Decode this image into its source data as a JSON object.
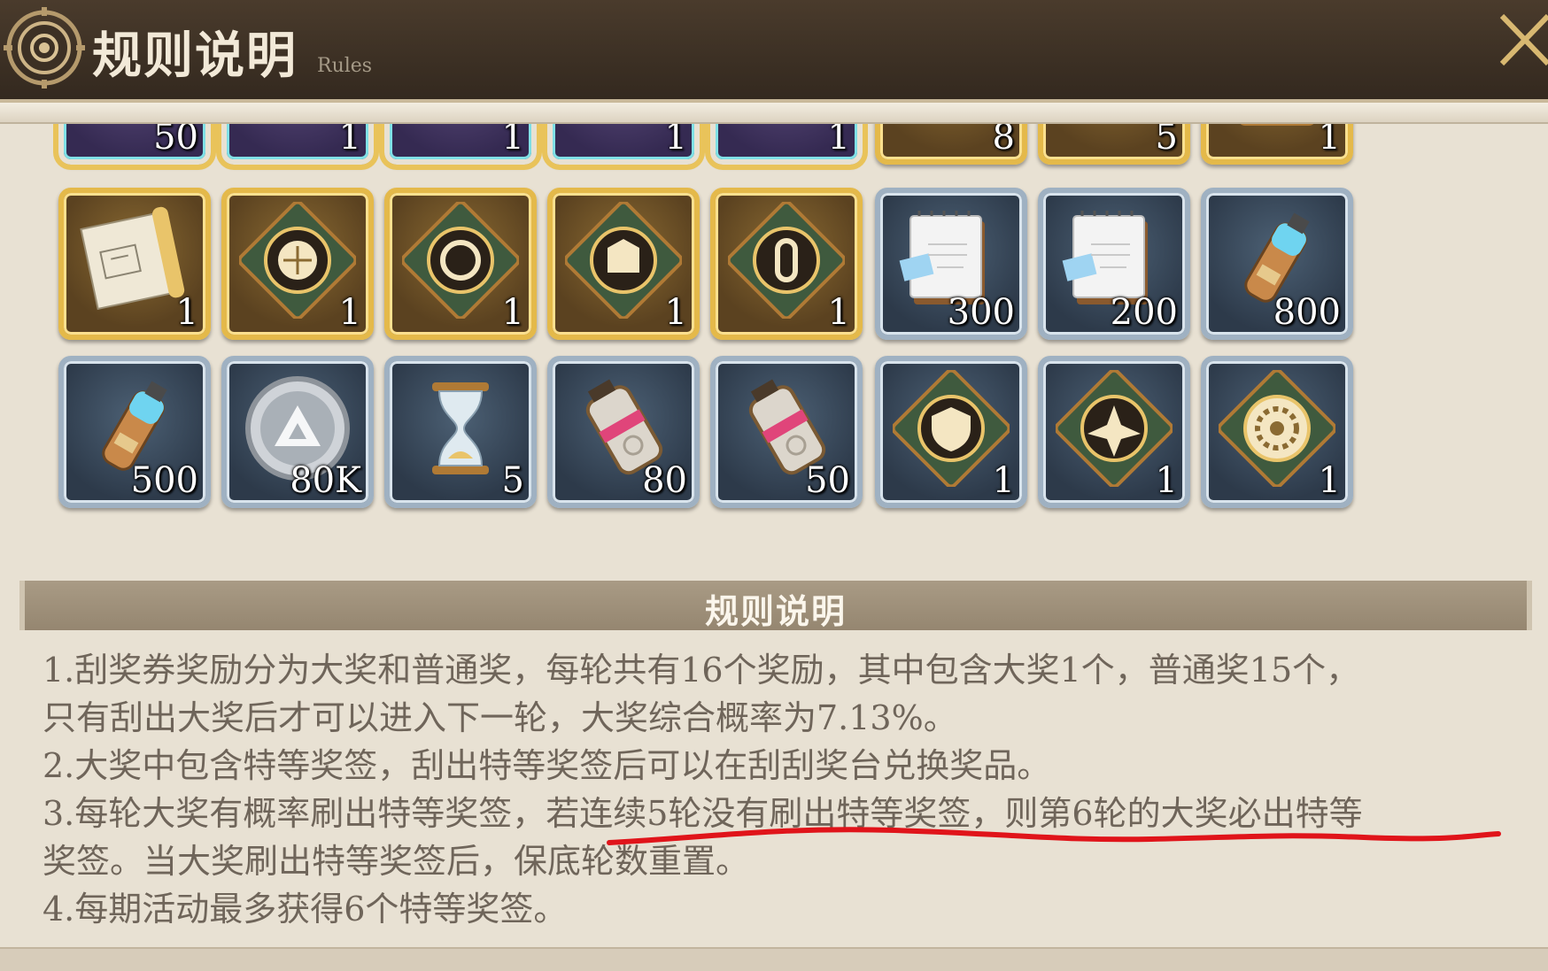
{
  "header": {
    "title": "规则说明",
    "subtitle": "Rules",
    "close_icon": "close-x-icon"
  },
  "colors": {
    "header_bg": "#3c3024",
    "gold_frame": "#e4b94a",
    "blue_frame": "#9fb1c2",
    "annotation_red": "#e0141a",
    "body_text": "#6f655a"
  },
  "rewards": {
    "row_partial": [
      {
        "qty": "50",
        "rarity": "rainbow",
        "icon": "unknown-item-icon"
      },
      {
        "qty": "1",
        "rarity": "rainbow",
        "icon": "unknown-item-icon"
      },
      {
        "qty": "1",
        "rarity": "rainbow",
        "icon": "unknown-item-icon"
      },
      {
        "qty": "1",
        "rarity": "rainbow",
        "icon": "unknown-item-icon"
      },
      {
        "qty": "1",
        "rarity": "rainbow",
        "icon": "unknown-item-icon"
      },
      {
        "qty": "8",
        "rarity": "gold",
        "icon": "unknown-item-icon"
      },
      {
        "qty": "5",
        "rarity": "gold",
        "icon": "unknown-item-icon"
      },
      {
        "qty": "1",
        "rarity": "gold",
        "icon": "green-gem-box-icon"
      }
    ],
    "row_1": [
      {
        "qty": "1",
        "rarity": "gold",
        "icon": "blueprint-scroll-icon"
      },
      {
        "qty": "1",
        "rarity": "gold",
        "icon": "module-shell-icon"
      },
      {
        "qty": "1",
        "rarity": "gold",
        "icon": "module-swirl-icon"
      },
      {
        "qty": "1",
        "rarity": "gold",
        "icon": "module-box-icon"
      },
      {
        "qty": "1",
        "rarity": "gold",
        "icon": "module-link-icon"
      },
      {
        "qty": "300",
        "rarity": "blue",
        "icon": "notebook-icon"
      },
      {
        "qty": "200",
        "rarity": "blue",
        "icon": "notebook-icon"
      },
      {
        "qty": "800",
        "rarity": "blue",
        "icon": "fuel-canister-icon"
      }
    ],
    "row_2": [
      {
        "qty": "500",
        "rarity": "blue",
        "icon": "fuel-canister-icon"
      },
      {
        "qty": "80K",
        "rarity": "blue",
        "icon": "silver-coin-icon"
      },
      {
        "qty": "5",
        "rarity": "blue",
        "icon": "hourglass-icon"
      },
      {
        "qty": "80",
        "rarity": "blue",
        "icon": "energy-cell-icon"
      },
      {
        "qty": "50",
        "rarity": "blue",
        "icon": "energy-cell-icon"
      },
      {
        "qty": "1",
        "rarity": "blue",
        "icon": "module-shield-icon"
      },
      {
        "qty": "1",
        "rarity": "blue",
        "icon": "module-tri-icon"
      },
      {
        "qty": "1",
        "rarity": "blue",
        "icon": "module-gear-icon"
      }
    ]
  },
  "rules": {
    "section_title": "规则说明",
    "lines": [
      "1.刮奖券奖励分为大奖和普通奖，每轮共有16个奖励，其中包含大奖1个，普通奖15个，",
      "只有刮出大奖后才可以进入下一轮，大奖综合概率为7.13%。",
      "2.大奖中包含特等奖签，刮出特等奖签后可以在刮刮奖台兑换奖品。",
      "3.每轮大奖有概率刷出特等奖签，若连续5轮没有刷出特等奖签，则第6轮的大奖必出特等",
      "奖签。当大奖刷出特等奖签后，保底轮数重置。",
      "4.每期活动最多获得6个特等奖签。"
    ]
  }
}
